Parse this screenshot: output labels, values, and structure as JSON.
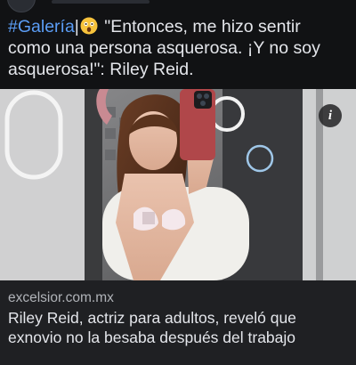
{
  "post": {
    "hashtag": "#Galería",
    "separator": "|",
    "emoji_name": "astonished-face-emoji",
    "caption_text": " \"Entonces, me hizo sentir como una persona asquerosa. ¡Y no soy asquerosa!\": Riley Reid."
  },
  "media": {
    "info_symbol": "i",
    "info_icon_name": "info-icon"
  },
  "link_preview": {
    "domain": "excelsior.com.mx",
    "headline": "Riley Reid, actriz para adultos, reveló que exnovio no la besaba después del trabajo"
  },
  "colors": {
    "background": "#111214",
    "hashtag": "#5b9df5",
    "text": "#e4e6eb",
    "muted_text": "#b0b3b8",
    "preview_bg": "#1f2023"
  }
}
